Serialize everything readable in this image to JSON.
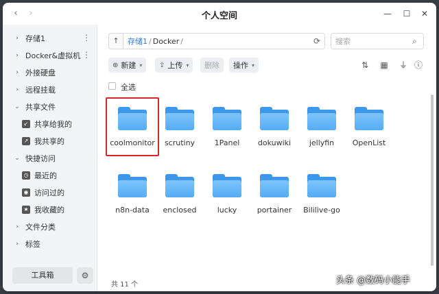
{
  "window": {
    "title": "个人空间"
  },
  "sidebar": {
    "items": [
      {
        "label": "存储1",
        "chevron": "›",
        "more": "⋮",
        "sub": false
      },
      {
        "label": "Docker&虚拟机",
        "chevron": "›",
        "more": "⋮",
        "sub": false
      },
      {
        "label": "外接硬盘",
        "chevron": "›",
        "sub": false
      },
      {
        "label": "远程挂载",
        "chevron": "›",
        "sub": false
      },
      {
        "label": "共享文件",
        "chevron": "⌄",
        "sub": false
      },
      {
        "label": "共享给我的",
        "icon": "share-in-icon",
        "sub": true
      },
      {
        "label": "我共享的",
        "icon": "share-out-icon",
        "sub": true
      },
      {
        "label": "快捷访问",
        "chevron": "⌄",
        "sub": false
      },
      {
        "label": "最近的",
        "icon": "clock-icon",
        "sub": true
      },
      {
        "label": "访问过的",
        "icon": "visited-icon",
        "sub": true
      },
      {
        "label": "我收藏的",
        "icon": "star-icon",
        "sub": true
      },
      {
        "label": "文件分类",
        "chevron": "›",
        "sub": false
      },
      {
        "label": "标签",
        "chevron": "›",
        "sub": false
      }
    ],
    "toolbox_label": "工具箱"
  },
  "path": {
    "crumbs": [
      "存储1",
      "Docker"
    ],
    "separator": "/"
  },
  "search": {
    "placeholder": "搜索"
  },
  "toolbar": {
    "new_label": "新建",
    "upload_label": "上传",
    "delete_label": "删除",
    "actions_label": "操作"
  },
  "select_all_label": "全选",
  "files": [
    {
      "name": "coolmonitor",
      "highlighted": true
    },
    {
      "name": "scrutiny"
    },
    {
      "name": "1Panel"
    },
    {
      "name": "dokuwiki"
    },
    {
      "name": "jellyfin"
    },
    {
      "name": "OpenList"
    },
    {
      "name": "n8n-data"
    },
    {
      "name": "enclosed"
    },
    {
      "name": "lucky"
    },
    {
      "name": "portainer"
    },
    {
      "name": "Bililive-go"
    }
  ],
  "status": {
    "count_text": "共 11 个"
  },
  "watermark": "头条 @数码小能手",
  "colors": {
    "accent": "#2e7cf6",
    "highlight_box": "#d8262b",
    "folder": "#55acf4"
  }
}
